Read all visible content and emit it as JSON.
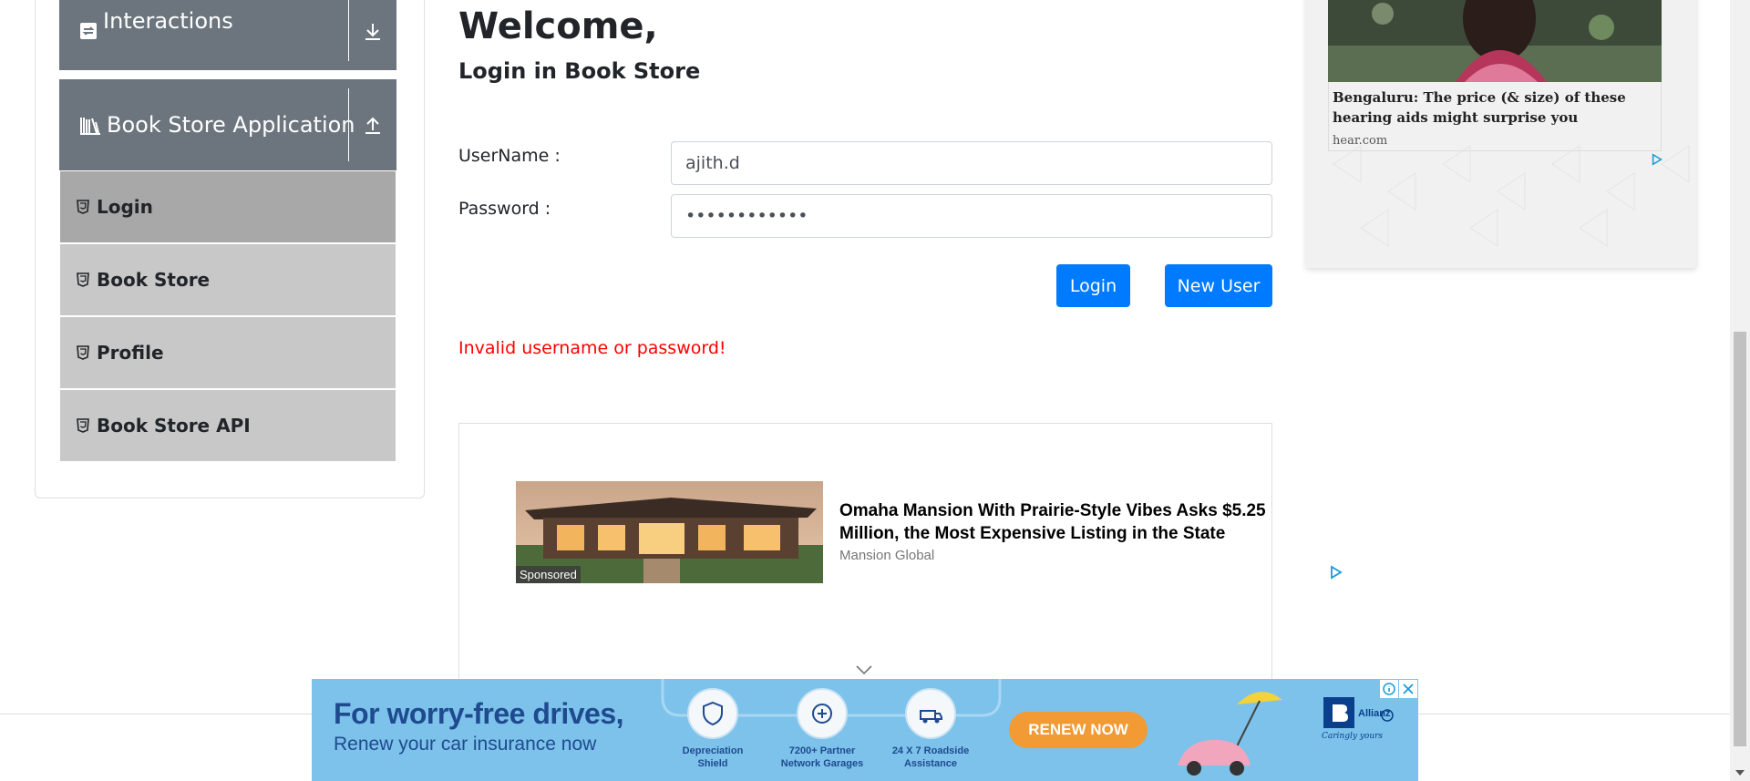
{
  "sidebar": {
    "groups": [
      {
        "label": "Interactions",
        "icon": "cycle-icon",
        "toggle": "download-arrow-icon"
      },
      {
        "label": "Book Store Application",
        "icon": "books-icon",
        "toggle": "upload-arrow-icon"
      }
    ],
    "items": [
      {
        "label": "Login",
        "icon": "html5-icon",
        "active": true
      },
      {
        "label": "Book Store",
        "icon": "html5-icon",
        "active": false
      },
      {
        "label": "Profile",
        "icon": "html5-icon",
        "active": false
      },
      {
        "label": "Book Store API",
        "icon": "html5-icon",
        "active": false
      }
    ]
  },
  "form": {
    "welcome": "Welcome,",
    "subtitle": "Login in Book Store",
    "username_label": "UserName :",
    "username_value": "ajith.d",
    "password_label": "Password :",
    "password_value": "••••••••••••",
    "login_label": "Login",
    "new_user_label": "New User",
    "error": "Invalid username or password!"
  },
  "ads": {
    "inline": {
      "badge": "Sponsored",
      "headline": "Omaha Mansion With Prairie-Style Vibes Asks $5.25 Million, the Most Expensive Listing in the State",
      "source": "Mansion Global"
    },
    "side": {
      "headline": "Bengaluru: The price (& size) of these hearing aids might surprise you",
      "source": "hear.com"
    },
    "banner": {
      "title": "For worry-free drives,",
      "subtitle": "Renew your car insurance now",
      "features": [
        {
          "line1": "Depreciation",
          "line2": "Shield"
        },
        {
          "line1": "7200+ Partner",
          "line2": "Network Garages"
        },
        {
          "line1": "24 X 7 Roadside",
          "line2": "Assistance"
        }
      ],
      "cta": "RENEW NOW",
      "brand": "Allianz",
      "tagline": "Caringly yours"
    }
  },
  "colors": {
    "primary": "#007bff",
    "error": "#ff0000",
    "group_header": "#6c757d",
    "menu_item": "#c8c8c8",
    "menu_item_active": "#a8a8a8"
  }
}
